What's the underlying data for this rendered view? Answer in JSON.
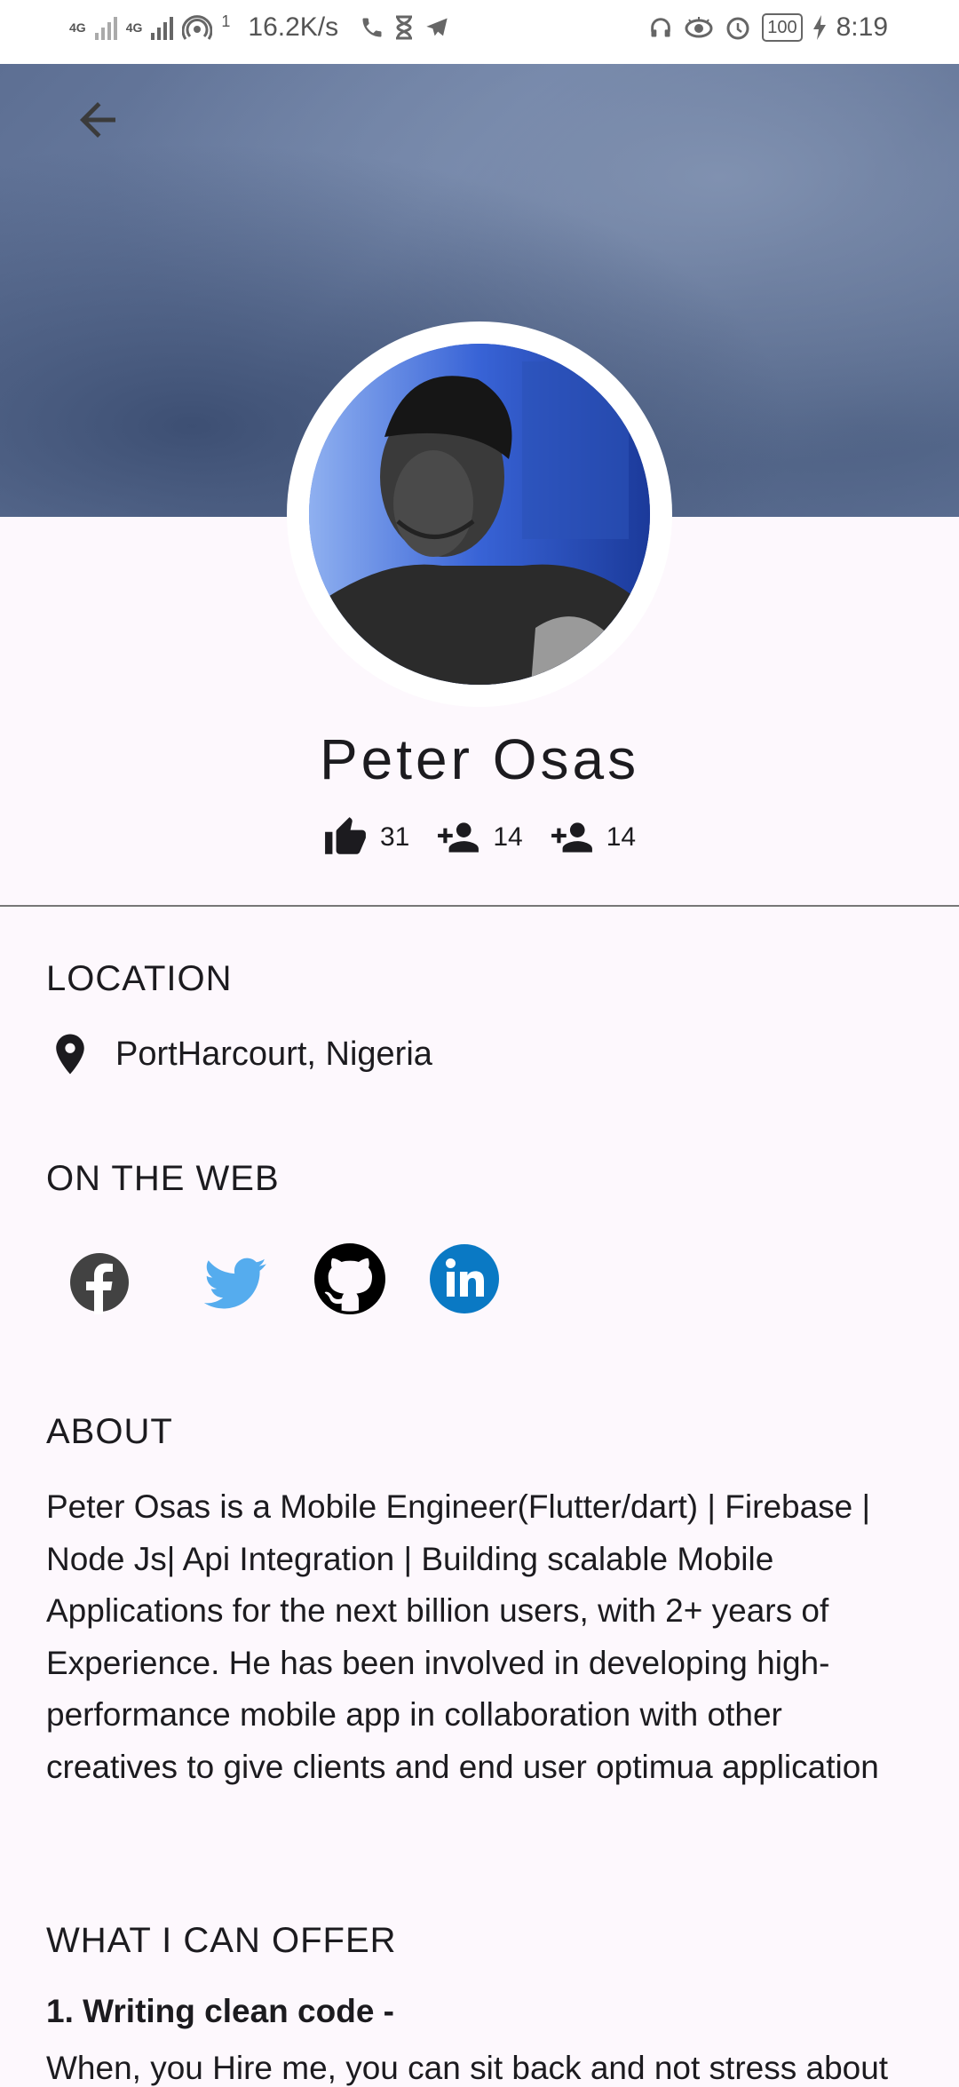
{
  "status_bar": {
    "net1": "4G",
    "net2": "4G",
    "hotspot_count": "1",
    "speed": "16.2K/s",
    "battery": "100",
    "time": "8:19"
  },
  "profile": {
    "name": "Peter Osas",
    "likes": "31",
    "followers": "14",
    "following": "14"
  },
  "location": {
    "title": "LOCATION",
    "value": "PortHarcourt, Nigeria"
  },
  "web": {
    "title": "ON THE WEB",
    "links": [
      {
        "icon": "facebook-icon",
        "color": "#424242"
      },
      {
        "icon": "twitter-icon",
        "color": "#55acee"
      },
      {
        "icon": "github-icon",
        "color": "#000000"
      },
      {
        "icon": "linkedin-icon",
        "color": "#0a79c4"
      }
    ]
  },
  "about": {
    "title": "ABOUT",
    "text": "Peter Osas is a Mobile Engineer(Flutter/dart) | Firebase | Node Js| Api Integration | Building scalable Mobile Applications for the next billion users, with 2+ years of Experience. He has been involved in developing high-performance mobile app in collaboration with other creatives to give clients and end user optimua application"
  },
  "offer": {
    "title": "WHAT I CAN OFFER",
    "item1_title": "1. Writing clean code -",
    "item1_desc": "When, you Hire me, you can sit back and not stress about"
  }
}
